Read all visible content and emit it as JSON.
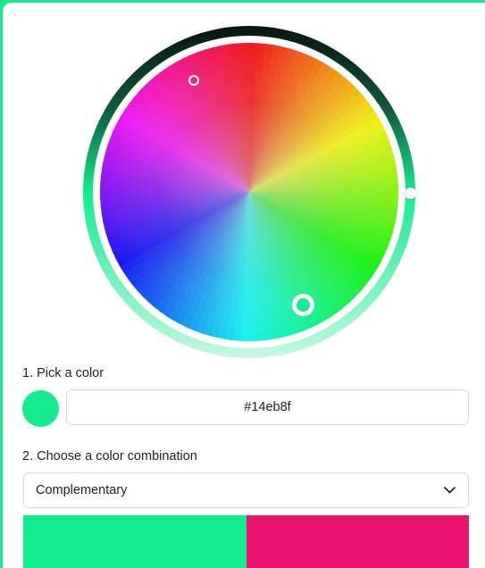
{
  "picker": {
    "selected_color": "#14eb8f",
    "brightness_gradient": [
      "#0a1210",
      "#0f5a3c",
      "#14eb8f",
      "#c5f8e2"
    ]
  },
  "step1": {
    "label": "1. Pick a color",
    "hex_value": "#14eb8f"
  },
  "step2": {
    "label": "2. Choose a color combination",
    "combination": "Complementary",
    "chevron_icon": "chevron-down-icon"
  },
  "palette": {
    "colors": [
      "#14eb8f",
      "#eb1470"
    ]
  }
}
